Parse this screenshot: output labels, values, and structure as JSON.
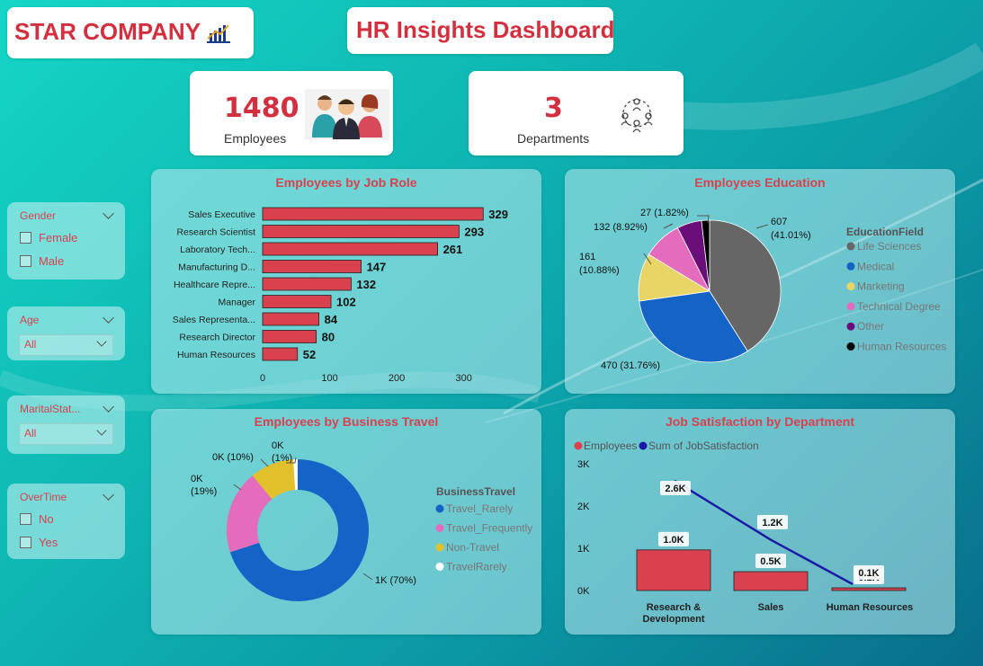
{
  "header": {
    "company": "STAR COMPANY",
    "dashboard_title": "HR Insights Dashboard"
  },
  "kpis": {
    "employees": {
      "value": "1480",
      "label": "Employees",
      "icon": "people-group-icon"
    },
    "departments": {
      "value": "3",
      "label": "Departments",
      "icon": "org-network-icon"
    }
  },
  "filters": {
    "gender": {
      "label": "Gender",
      "options": [
        "Female",
        "Male"
      ]
    },
    "age": {
      "label": "Age",
      "selected": "All"
    },
    "marital": {
      "label": "MaritalStat...",
      "selected": "All"
    },
    "overtime": {
      "label": "OverTime",
      "options": [
        "No",
        "Yes"
      ]
    }
  },
  "colors": {
    "accent": "#d2303f",
    "bar": "#d9414f",
    "life_sciences": "#666666",
    "medical": "#1464c8",
    "marketing": "#e8d566",
    "technical_degree": "#e36cbc",
    "other": "#6a0f7a",
    "human_resources": "#000000",
    "travel_rarely": "#1464c8",
    "travel_frequently": "#e36cbc",
    "non_travel": "#e2c02b",
    "travelrarely": "#ffffff",
    "line": "#1a1aa6"
  },
  "chart_data": [
    {
      "id": "job_role",
      "type": "bar",
      "orientation": "horizontal",
      "title": "Employees by Job Role",
      "categories": [
        "Sales Executive",
        "Research Scientist",
        "Laboratory Tech...",
        "Manufacturing D...",
        "Healthcare Repre...",
        "Manager",
        "Sales Representa...",
        "Research Director",
        "Human Resources"
      ],
      "values": [
        329,
        293,
        261,
        147,
        132,
        102,
        84,
        80,
        52
      ],
      "xticks": [
        "0",
        "100",
        "200",
        "300"
      ],
      "xlim": [
        0,
        330
      ]
    },
    {
      "id": "education",
      "type": "pie",
      "title": "Employees Education",
      "legend_title": "EducationField",
      "legend_position": "right",
      "slices": [
        {
          "name": "Life Sciences",
          "value": 607,
          "label": "607\n(41.01%)"
        },
        {
          "name": "Medical",
          "value": 470,
          "label": "470 (31.76%)"
        },
        {
          "name": "Marketing",
          "value": 161,
          "label": "161\n(10.88%)"
        },
        {
          "name": "Technical Degree",
          "value": 132,
          "label": "132 (8.92%)"
        },
        {
          "name": "Other",
          "value": 83,
          "label": ""
        },
        {
          "name": "Human Resources",
          "value": 27,
          "label": "27 (1.82%)"
        }
      ]
    },
    {
      "id": "travel",
      "type": "donut",
      "title": "Employees by Business Travel",
      "legend_title": "BusinessTravel",
      "legend_position": "right",
      "slices": [
        {
          "name": "Travel_Rarely",
          "value": 70,
          "label": "1K (70%)"
        },
        {
          "name": "Travel_Frequently",
          "value": 19,
          "label": "0K\n(19%)"
        },
        {
          "name": "Non-Travel",
          "value": 10,
          "label": "0K (10%)"
        },
        {
          "name": "TravelRarely",
          "value": 1,
          "label": "0K\n(1%)"
        }
      ]
    },
    {
      "id": "satisfaction",
      "type": "bar+line",
      "title": "Job Satisfaction by Department",
      "legend_position": "top-left",
      "categories": [
        "Research & Development",
        "Sales",
        "Human Resources"
      ],
      "category_labels": [
        [
          "Research &",
          "Development"
        ],
        [
          "Sales"
        ],
        [
          "Human Resources"
        ]
      ],
      "series": [
        {
          "name": "Employees",
          "type": "bar",
          "values": [
            961,
            446,
            63
          ],
          "labels": [
            "1.0K",
            "0.5K",
            "0.1K"
          ]
        },
        {
          "name": "Sum of JobSatisfaction",
          "type": "line",
          "values": [
            2600,
            1200,
            150
          ],
          "labels": [
            "2.6K",
            "1.2K",
            "0.1K"
          ]
        }
      ],
      "yticks": [
        "0K",
        "1K",
        "2K",
        "3K"
      ],
      "ylim": [
        0,
        3000
      ]
    }
  ]
}
